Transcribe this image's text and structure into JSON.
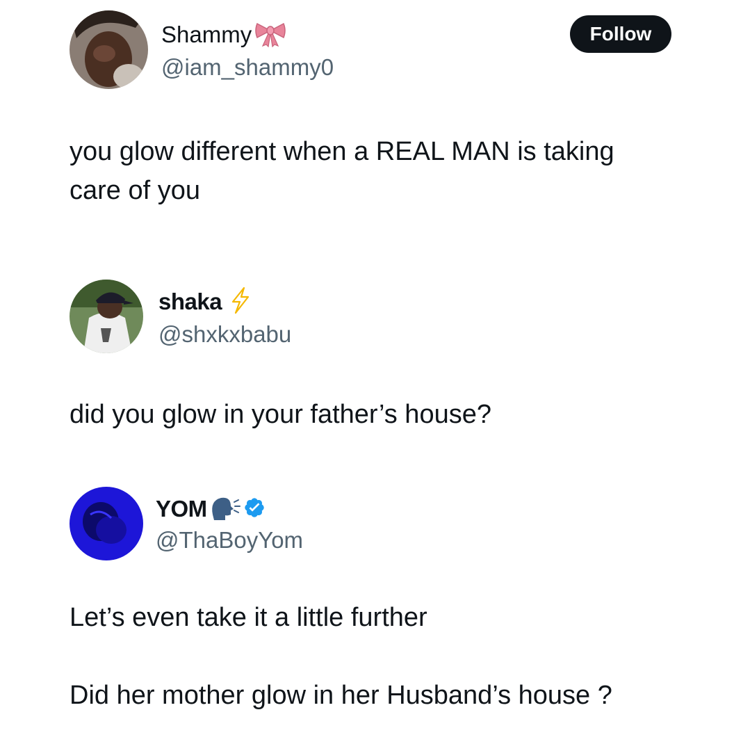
{
  "posts": [
    {
      "display_name": "Shammy",
      "name_emoji": "bow-emoji",
      "handle": "@iam_shammy0",
      "text": "you glow different when a REAL MAN is taking\ncare of you",
      "follow_label": "Follow"
    },
    {
      "display_name": "shaka",
      "name_emoji": "lightning-emoji",
      "handle": "@shxkxbabu",
      "text": "did you glow in your father’s house?"
    },
    {
      "display_name": "YOM",
      "name_emoji": "speaking-head-emoji",
      "verified_icon": "verified-badge-icon",
      "handle": "@ThaBoyYom",
      "text": "Let’s even take it a little further\n\nDid her mother glow in her Husband’s house ?"
    }
  ],
  "colors": {
    "text": "#0f1419",
    "handle": "#536471",
    "follow_bg": "#0f1419",
    "verified": "#1d9bf0",
    "lightning": "#f5b800",
    "bow": "#e8849a"
  }
}
